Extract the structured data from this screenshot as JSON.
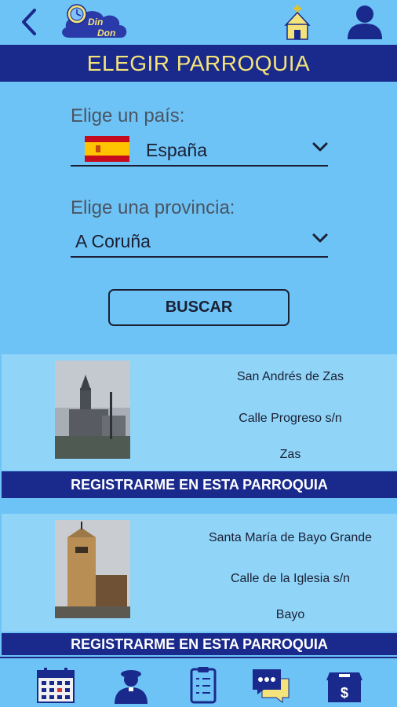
{
  "header": {
    "logo_text": [
      "Din",
      "Don"
    ],
    "title": "ELEGIR PARROQUIA"
  },
  "form": {
    "country_label": "Elige un país:",
    "country_value": "España",
    "province_label": "Elige una provincia:",
    "province_value": "A Coruña",
    "search_label": "BUSCAR"
  },
  "parishes": [
    {
      "name": "San Andrés de Zas",
      "address": "Calle Progreso s/n",
      "town": "Zas",
      "register_label": "REGISTRARME EN ESTA PARROQUIA"
    },
    {
      "name": "Santa María de Bayo Grande",
      "address": "Calle de la Iglesia s/n",
      "town": "Bayo",
      "register_label": "REGISTRARME EN ESTA PARROQUIA"
    }
  ],
  "bottom_nav": [
    {
      "icon": "calendar-icon"
    },
    {
      "icon": "priest-icon"
    },
    {
      "icon": "checklist-icon"
    },
    {
      "icon": "chat-icon"
    },
    {
      "icon": "donation-box-icon"
    }
  ],
  "colors": {
    "background": "#6ec3f6",
    "navy": "#1a2a8c",
    "title_text": "#f4e37a",
    "card": "#90d4f7"
  }
}
